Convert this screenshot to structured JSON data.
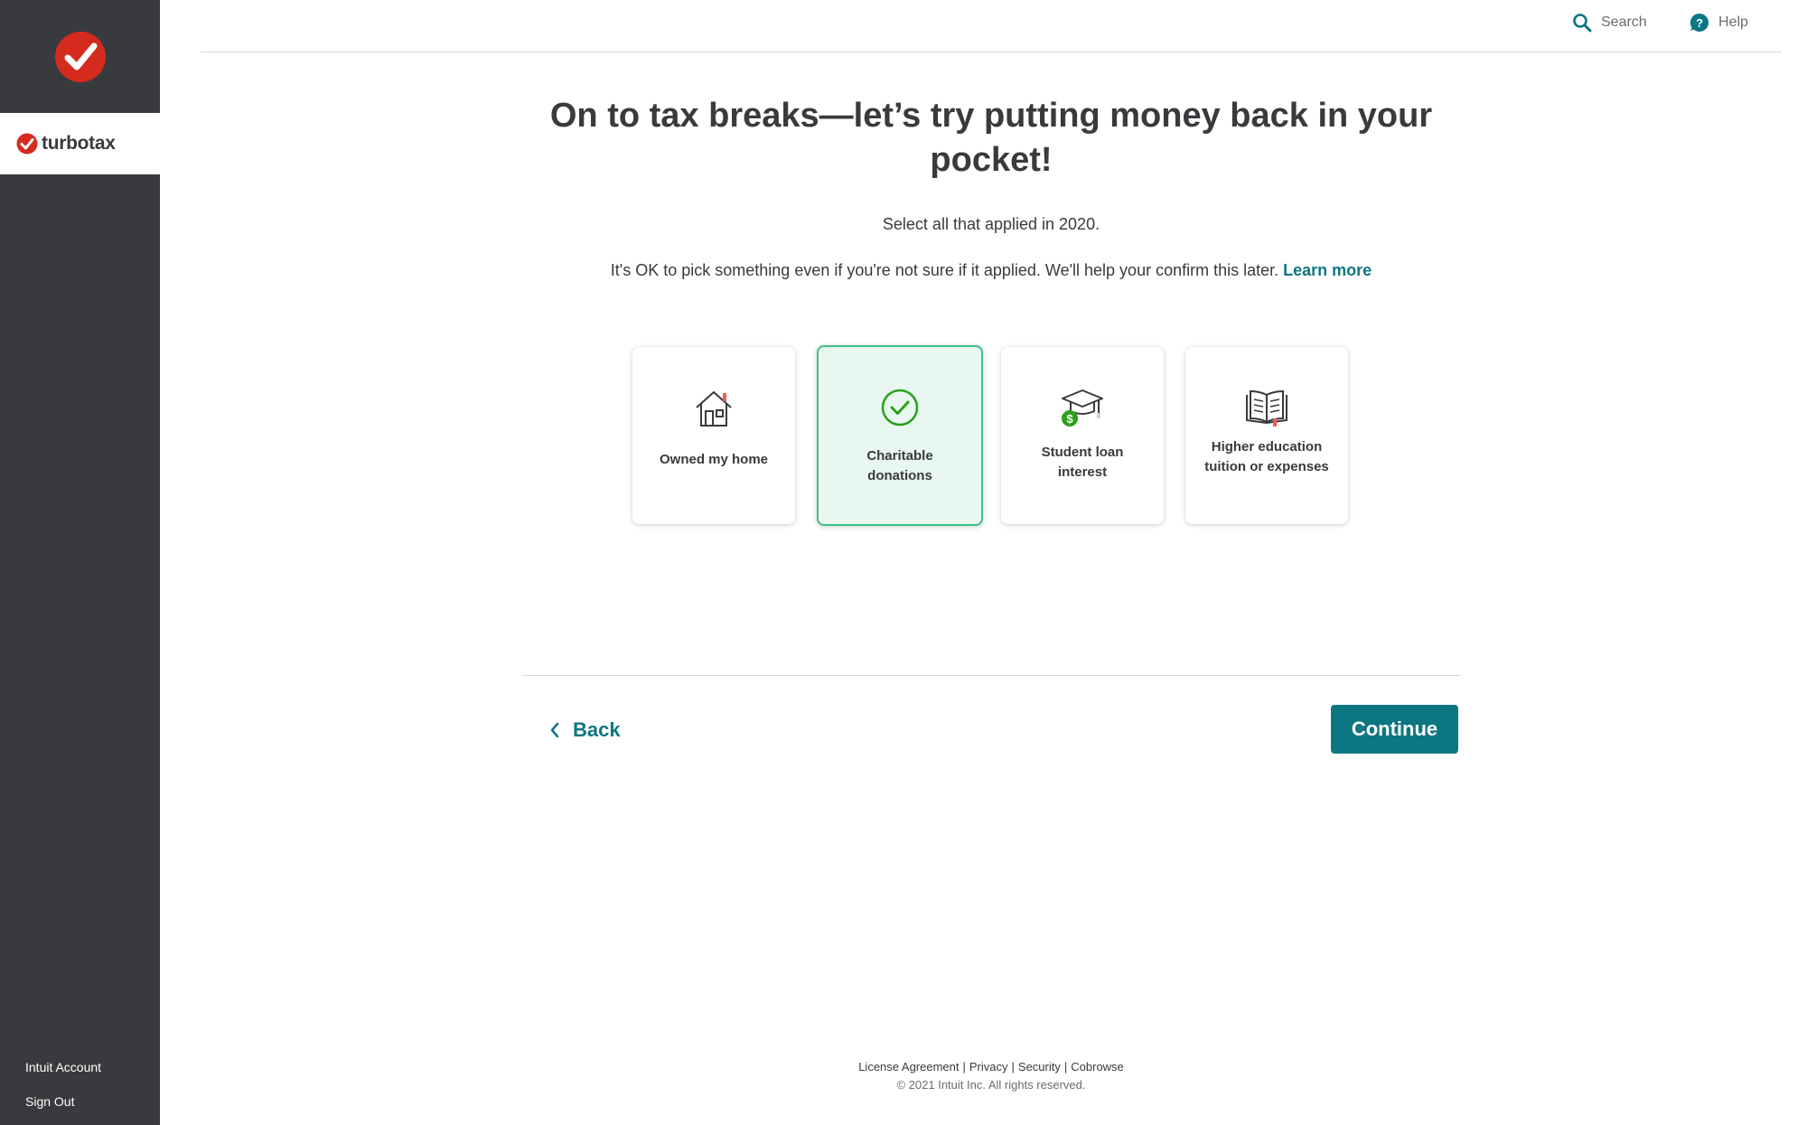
{
  "sidebar": {
    "brand": "turbotax",
    "links": [
      "Intuit Account",
      "Sign Out"
    ]
  },
  "topbar": {
    "search_label": "Search",
    "help_label": "Help"
  },
  "main": {
    "title": "On to tax breaks—let’s try putting money back in your pocket!",
    "subtitle": "Select all that applied in 2020.",
    "note": "It's OK to pick something even if you're not sure if it applied. We'll help your confirm this later.",
    "learn_more": "Learn more",
    "cards": [
      {
        "label": "Owned my home",
        "icon": "house-icon",
        "selected": false
      },
      {
        "label": "Charitable donations",
        "icon": "check-circle-icon",
        "selected": true
      },
      {
        "label": "Student loan interest",
        "icon": "graduation-cap-icon",
        "selected": false
      },
      {
        "label": "Higher education tuition or expenses",
        "icon": "open-book-icon",
        "selected": false
      }
    ]
  },
  "nav": {
    "back_label": "Back",
    "continue_label": "Continue"
  },
  "footer": {
    "links": [
      "License Agreement",
      "Privacy",
      "Security",
      "Cobrowse"
    ],
    "copyright": "© 2021 Intuit Inc. All rights reserved."
  },
  "colors": {
    "sidebar_bg": "#393a3d",
    "accent": "#0d7683",
    "selected_border": "#3ec088",
    "brand_red": "#d52b1e"
  }
}
